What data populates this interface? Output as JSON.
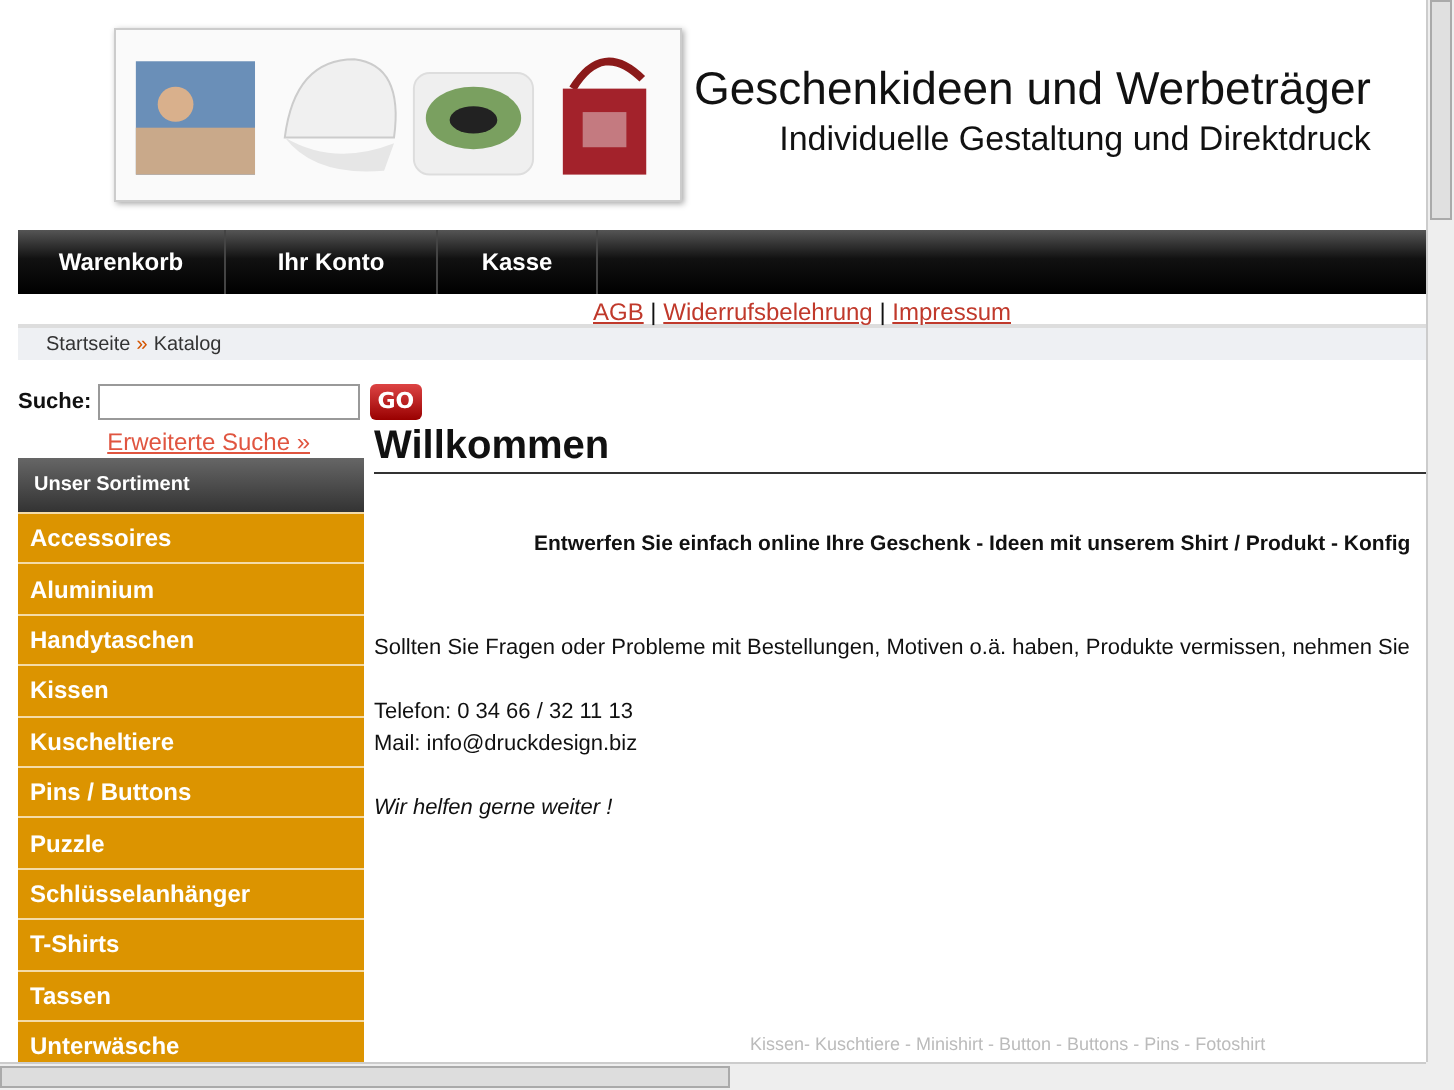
{
  "header": {
    "title": "Geschenkideen und Werbeträger",
    "subtitle": "Individuelle Gestaltung und Direktdruck"
  },
  "nav": [
    {
      "label": "Warenkorb"
    },
    {
      "label": "Ihr Konto"
    },
    {
      "label": "Kasse"
    }
  ],
  "legal_links": [
    "AGB",
    "Widerrufsbelehrung",
    "Impressum"
  ],
  "legal_separator": "|",
  "breadcrumb": {
    "items": [
      "Startseite",
      "Katalog"
    ],
    "separator": "»"
  },
  "search": {
    "label": "Suche:",
    "button": "GO",
    "advanced": "Erweiterte Suche »"
  },
  "sidebar": {
    "title": "Unser Sortiment",
    "items": [
      "Accessoires",
      "Aluminium",
      "Handytaschen",
      "Kissen",
      "Kuscheltiere",
      "Pins / Buttons",
      "Puzzle",
      "Schlüsselanhänger",
      "T-Shirts",
      "Tassen",
      "Unterwäsche"
    ]
  },
  "main": {
    "heading": "Willkommen",
    "intro": "Entwerfen Sie einfach online Ihre Geschenk - Ideen mit unserem Shirt / Produkt - Konfig",
    "paragraph": "Sollten Sie Fragen oder Probleme mit Bestellungen, Motiven o.ä. haben, Produkte vermissen, nehmen Sie",
    "phone": "Telefon: 0 34 66 / 32 11 13",
    "mail": "Mail: info@druckdesign.biz",
    "closing": "Wir helfen gerne weiter !",
    "footer_tags": "Kissen- Kuschtiere - Minishirt - Button - Buttons - Pins - Fotoshirt"
  }
}
